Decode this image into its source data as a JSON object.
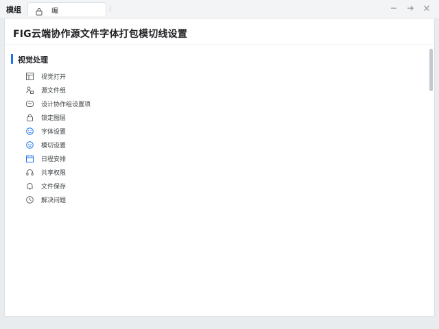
{
  "app": {
    "top_title": "模组",
    "tab_label": "编"
  },
  "page": {
    "title": "FIG云端协作源文件字体打包模切线设置"
  },
  "section": {
    "title": "视觉处理"
  },
  "items": [
    {
      "label": "视觉打开",
      "icon": "layout-icon"
    },
    {
      "label": "源文件组",
      "icon": "user-lock-icon"
    },
    {
      "label": "设计协作组设置项",
      "icon": "chat-bubble-icon"
    },
    {
      "label": "锁定图层",
      "icon": "lock-icon"
    },
    {
      "label": "字体设置",
      "icon": "smile-icon"
    },
    {
      "label": "模切设置",
      "icon": "face-icon"
    },
    {
      "label": "日程安排",
      "icon": "calendar-icon"
    },
    {
      "label": "共享权限",
      "icon": "headset-icon"
    },
    {
      "label": "文件保存",
      "icon": "bell-icon"
    },
    {
      "label": "解决问题",
      "icon": "clock-icon"
    }
  ],
  "colors": {
    "accent": "#1a73e8",
    "icon": "#5f6368"
  }
}
